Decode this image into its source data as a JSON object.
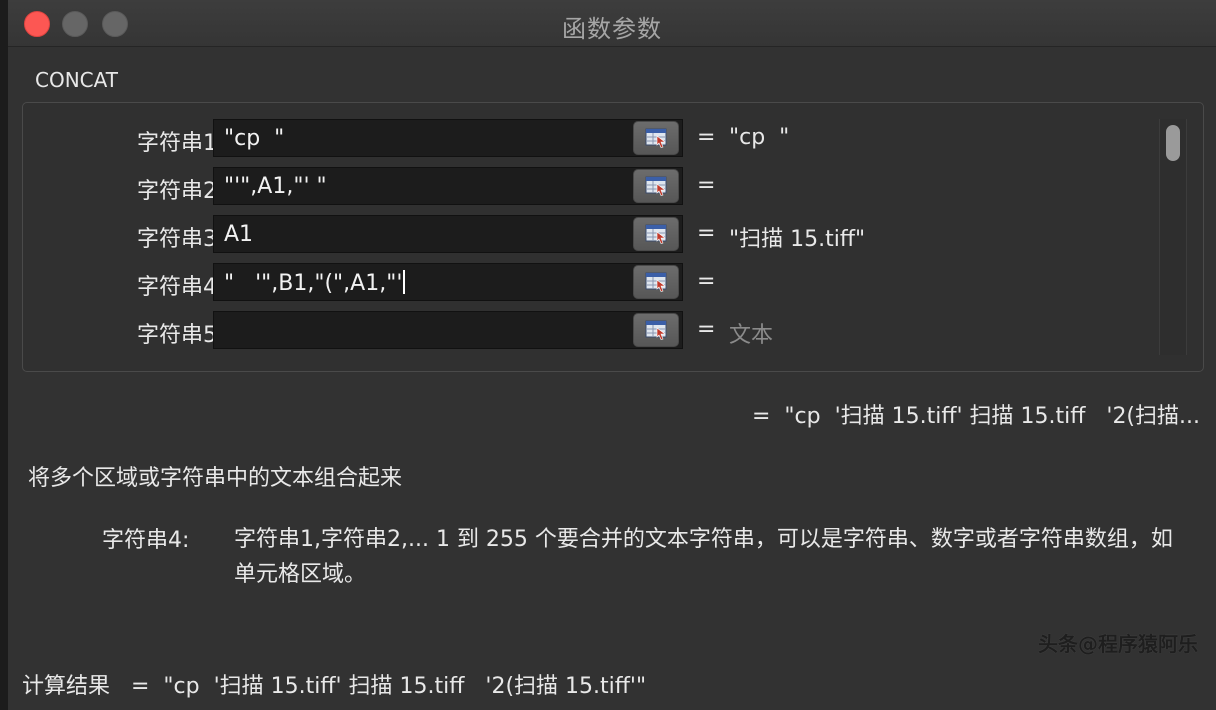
{
  "window": {
    "title": "函数参数",
    "colors": {
      "close": "#fc5753",
      "background": "#323232"
    }
  },
  "function_name": "CONCAT",
  "args": [
    {
      "label": "字符串1",
      "value": "\"cp  \"",
      "result": "\"cp  \""
    },
    {
      "label": "字符串2",
      "value": "\"'\",A1,\"' \"",
      "result": ""
    },
    {
      "label": "字符串3",
      "value": "A1",
      "result": "\"扫描 15.tiff\""
    },
    {
      "label": "字符串4",
      "value": "\"   '\",B1,\"(\",A1,\"'",
      "result": ""
    },
    {
      "label": "字符串5",
      "value": "",
      "result": "",
      "placeholder": "文本"
    }
  ],
  "eq_sign": "=",
  "overall_result": "=  \"cp  '扫描 15.tiff' 扫描 15.tiff   '2(扫描...",
  "description": "将多个区域或字符串中的文本组合起来",
  "help": {
    "label": "字符串4:",
    "text": "字符串1,字符串2,... 1 到 255 个要合并的文本字符串，可以是字符串、数字或者字符串数组，如单元格区域。"
  },
  "watermark": "头条@程序猿阿乐",
  "calc_result": {
    "label": "计算结果",
    "value": "=  \"cp  '扫描 15.tiff' 扫描 15.tiff   '2(扫描 15.tiff'\""
  }
}
